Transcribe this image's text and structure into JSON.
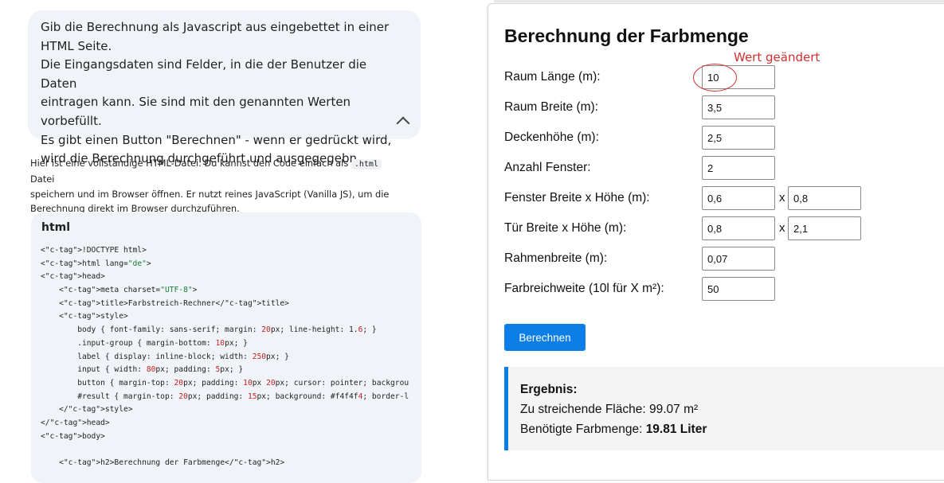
{
  "prompt": {
    "lines": [
      "Gib die Berechnung als Javascript aus eingebettet in einer",
      "HTML Seite.",
      "Die Eingangsdaten sind Felder, in die der Benutzer die Daten",
      "eintragen kann. Sie sind mit den genannten Werten vorbefüllt.",
      "Es gibt einen Button \"Berechnen\" - wenn er gedrückt wird,",
      "wird die Berechnung durchgeführt und ausgegegebn"
    ]
  },
  "answer": {
    "line1_pre": "Hier ist eine vollständige HTML-Datei. Du kannst den Code einfach als ",
    "line1_code": ".html",
    "line1_post": " Datei",
    "line2": "speichern und im Browser öffnen. Er nutzt reines JavaScript (Vanilla JS), um die",
    "line3": "Berechnung direkt im Browser durchzuführen."
  },
  "code_block": {
    "language": "html",
    "lines": [
      "<!DOCTYPE html>",
      "<html lang=\"de\">",
      "<head>",
      "    <meta charset=\"UTF-8\">",
      "    <title>Farbstreich-Rechner</title>",
      "    <style>",
      "        body { font-family: sans-serif; margin: 20px; line-height: 1.6; }",
      "        .input-group { margin-bottom: 10px; }",
      "        label { display: inline-block; width: 250px; }",
      "        input { width: 80px; padding: 5px; }",
      "        button { margin-top: 20px; padding: 10px 20px; cursor: pointer; backgrou",
      "        #result { margin-top: 20px; padding: 15px; background: #f4f4f4; border-l",
      "    </style>",
      "</head>",
      "<body>",
      "",
      "    <h2>Berechnung der Farbmenge</h2>"
    ]
  },
  "calculator": {
    "title": "Berechnung der Farbmenge",
    "annotation": "Wert geändert",
    "fields": {
      "laenge": {
        "label": "Raum Länge (m):",
        "value": "10"
      },
      "breite": {
        "label": "Raum Breite (m):",
        "value": "3,5"
      },
      "hoehe": {
        "label": "Deckenhöhe (m):",
        "value": "2,5"
      },
      "fenster_anzahl": {
        "label": "Anzahl Fenster:",
        "value": "2"
      },
      "fenster": {
        "label": "Fenster Breite x Höhe (m):",
        "value_w": "0,6",
        "value_h": "0,8",
        "sep": "x"
      },
      "tuer": {
        "label": "Tür Breite x Höhe (m):",
        "value_w": "0,8",
        "value_h": "2,1",
        "sep": "x"
      },
      "rahmen": {
        "label": "Rahmenbreite (m):",
        "value": "0,07"
      },
      "reichweite": {
        "label": "Farbreichweite (10l für X m²):",
        "value": "50"
      }
    },
    "button_label": "Berechnen",
    "result": {
      "heading": "Ergebnis:",
      "area_label": "Zu streichende Fläche: ",
      "area_value": "99.07 m²",
      "paint_label": "Benötigte Farbmenge: ",
      "paint_value": "19.81 Liter"
    }
  },
  "colors": {
    "accent": "#0d7de8",
    "annotation": "#d32f2f",
    "bubble_bg": "#f0f4f9",
    "result_bg": "#f4f4f4"
  }
}
